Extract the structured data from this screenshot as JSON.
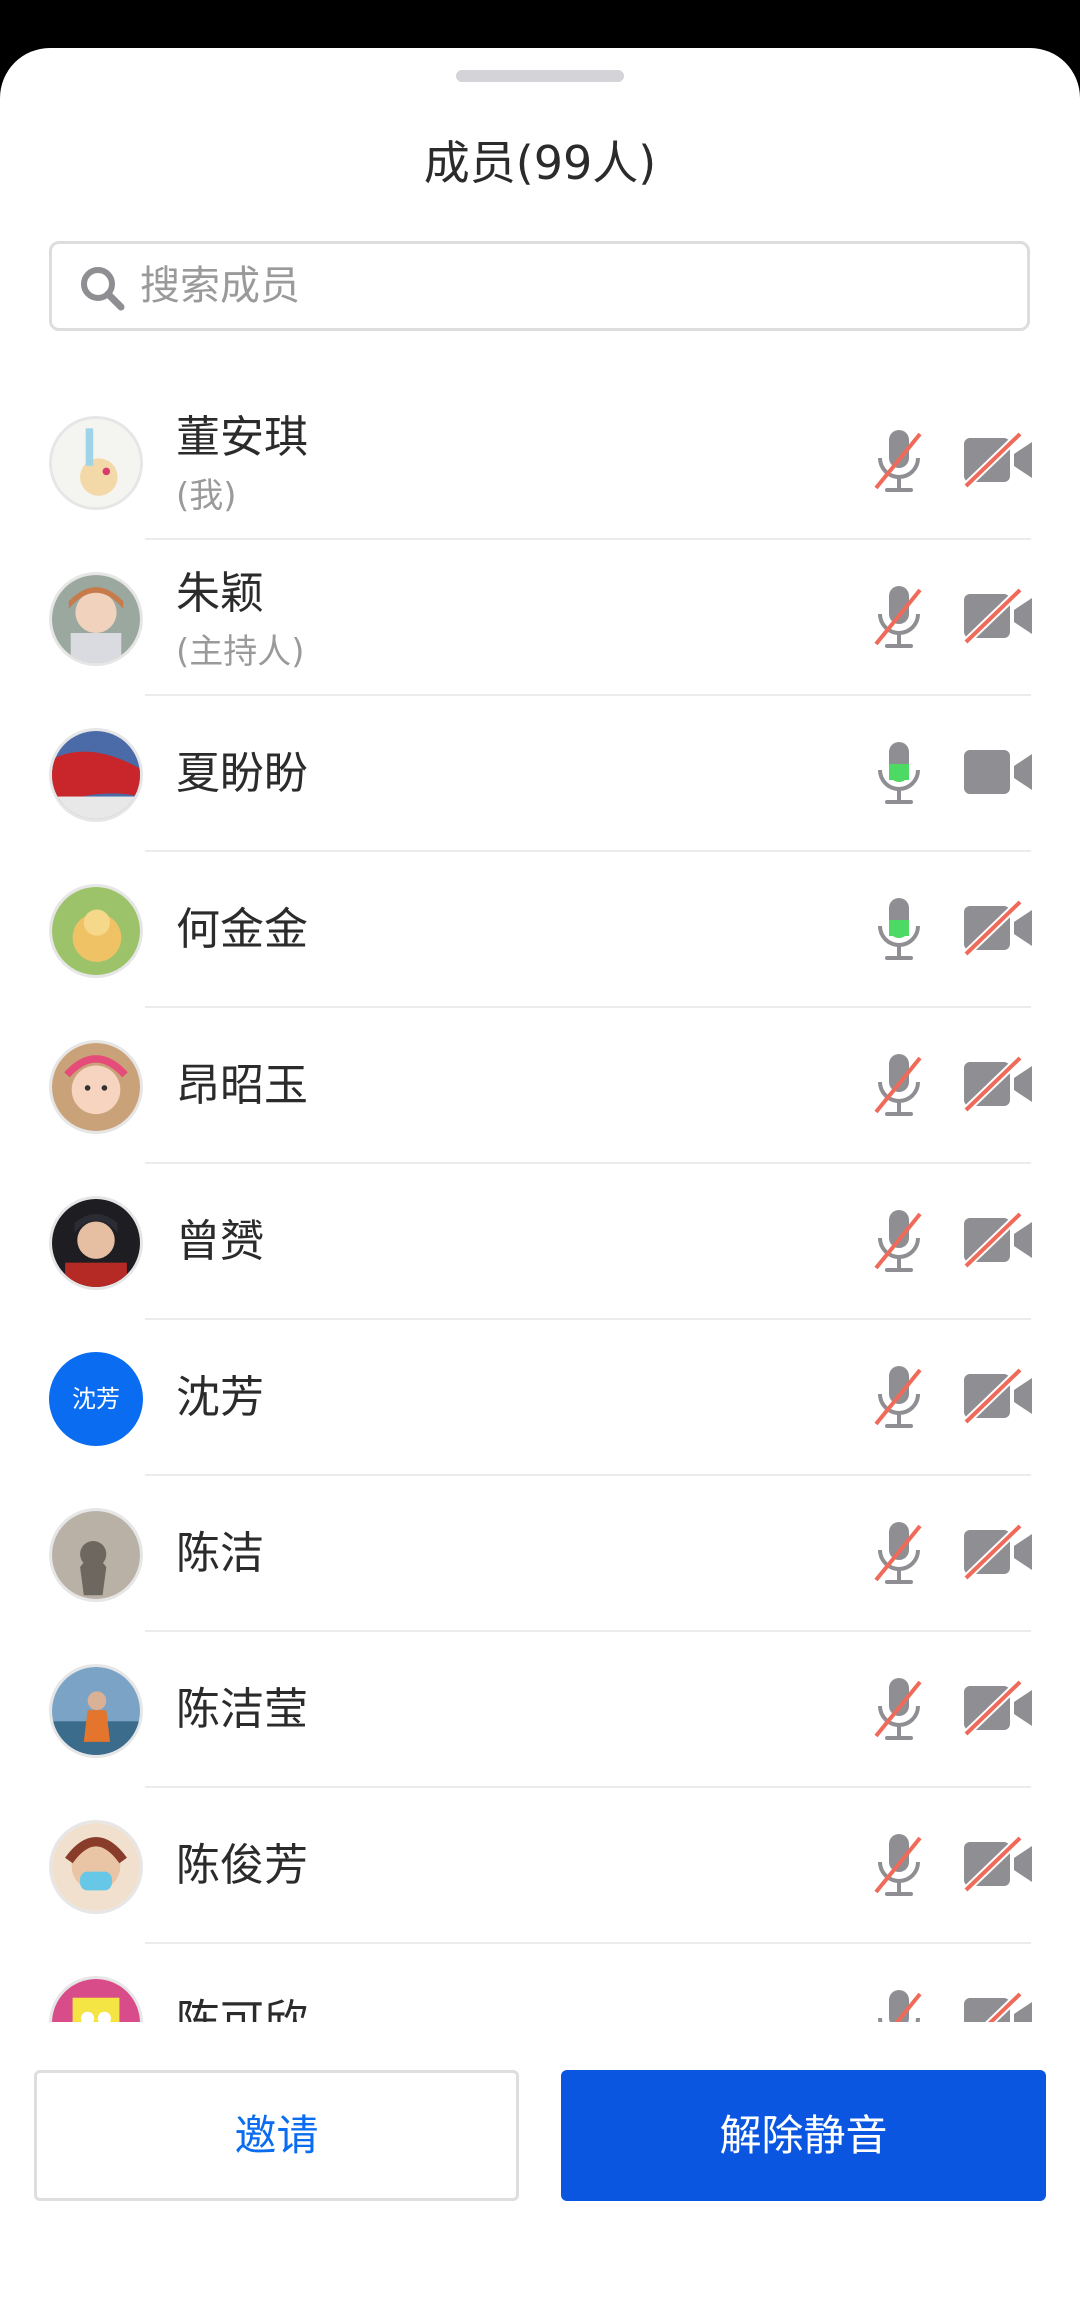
{
  "header": {
    "title": "成员(99人)"
  },
  "search": {
    "placeholder": "搜索成员",
    "value": ""
  },
  "members": [
    {
      "name": "董安琪",
      "role": "(我)",
      "mic": "muted",
      "camera": "off",
      "avatar_kind": "image"
    },
    {
      "name": "朱颖",
      "role": "(主持人)",
      "mic": "muted",
      "camera": "off",
      "avatar_kind": "image"
    },
    {
      "name": "夏盼盼",
      "role": "",
      "mic": "speaking",
      "camera": "on",
      "avatar_kind": "image"
    },
    {
      "name": "何金金",
      "role": "",
      "mic": "speaking",
      "camera": "off",
      "avatar_kind": "image"
    },
    {
      "name": "昂昭玉",
      "role": "",
      "mic": "muted",
      "camera": "off",
      "avatar_kind": "image"
    },
    {
      "name": "曾赟",
      "role": "",
      "mic": "muted",
      "camera": "off",
      "avatar_kind": "image"
    },
    {
      "name": "沈芳",
      "role": "",
      "mic": "muted",
      "camera": "off",
      "avatar_kind": "text",
      "avatar_text": "沈芳"
    },
    {
      "name": "陈洁",
      "role": "",
      "mic": "muted",
      "camera": "off",
      "avatar_kind": "image"
    },
    {
      "name": "陈洁莹",
      "role": "",
      "mic": "muted",
      "camera": "off",
      "avatar_kind": "image"
    },
    {
      "name": "陈俊芳",
      "role": "",
      "mic": "muted",
      "camera": "off",
      "avatar_kind": "image"
    },
    {
      "name": "陈可欣",
      "role": "",
      "mic": "muted",
      "camera": "off",
      "avatar_kind": "image"
    }
  ],
  "footer": {
    "invite_label": "邀请",
    "unmute_label": "解除静音"
  },
  "colors": {
    "accent": "#0a56e0",
    "avatar_text_bg": "#0a6cf0",
    "speaking": "#4cd964",
    "muted_strike": "#f06a5a",
    "icon_gray": "#8e8e93"
  },
  "icons": {
    "search": "search-icon",
    "mic": "microphone-icon",
    "mic_muted": "microphone-muted-icon",
    "camera": "video-camera-icon",
    "camera_off": "video-camera-off-icon"
  }
}
